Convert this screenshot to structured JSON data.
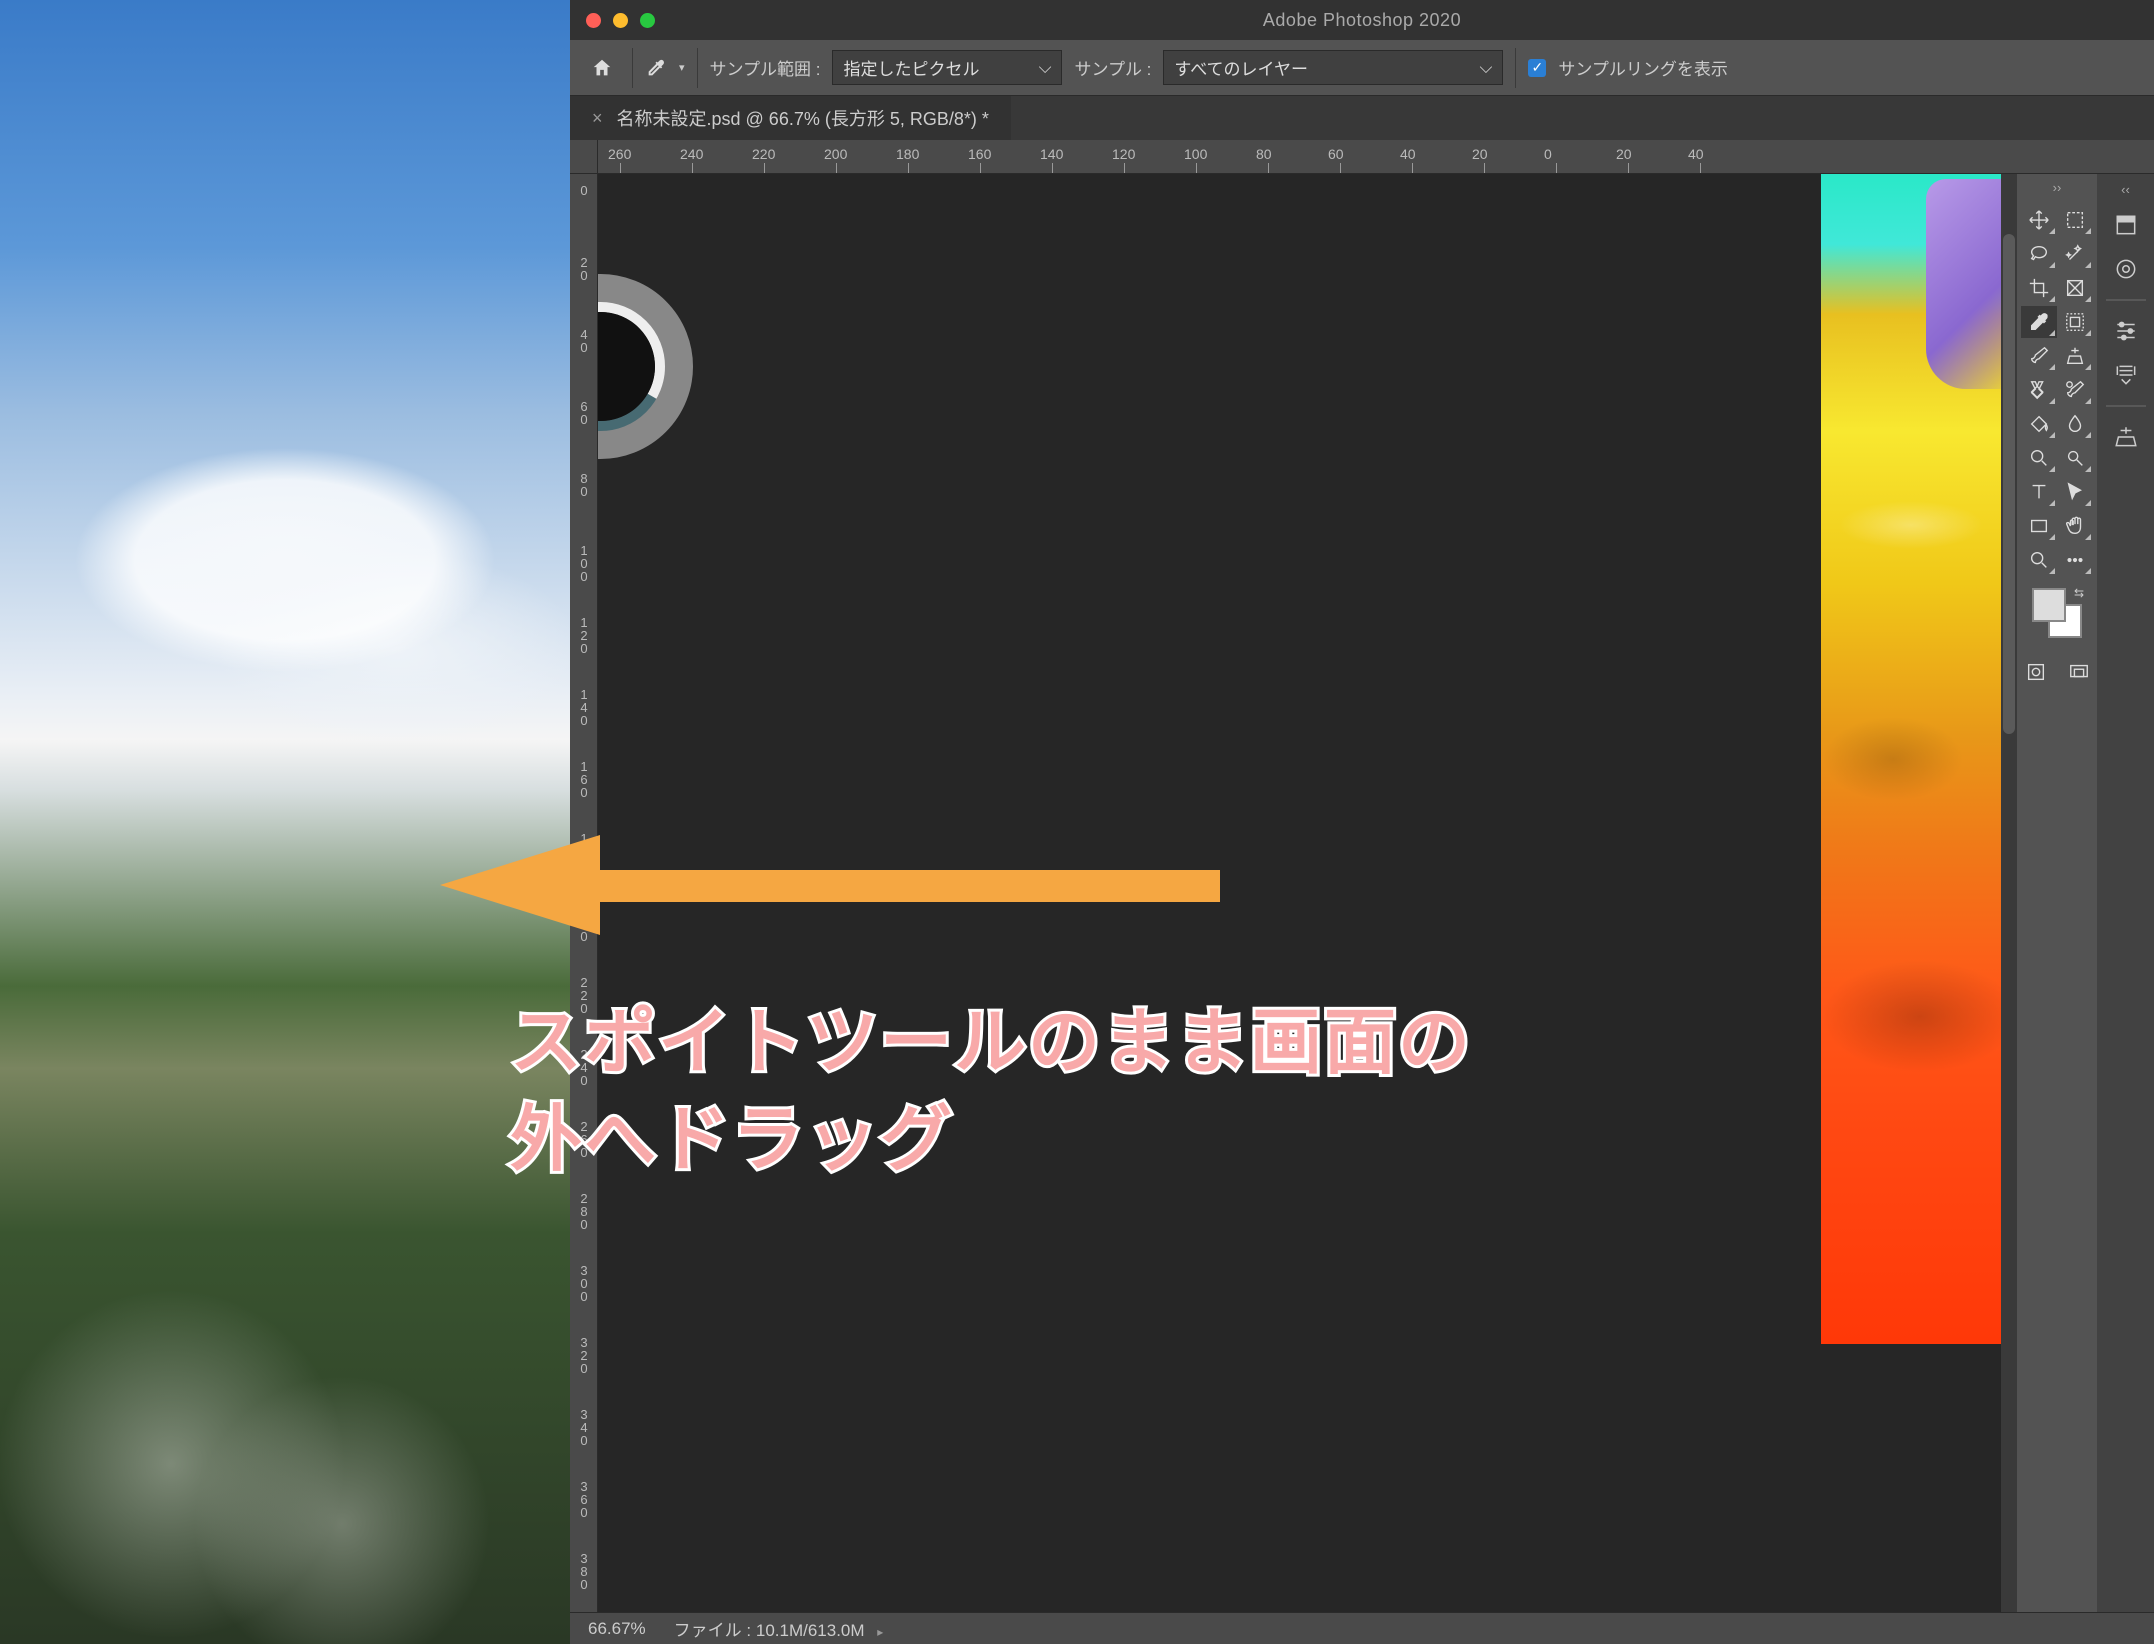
{
  "app_title": "Adobe Photoshop 2020",
  "options_bar": {
    "sample_size_label": "サンプル範囲 :",
    "sample_size_value": "指定したピクセル",
    "sample_layer_label": "サンプル :",
    "sample_layer_value": "すべてのレイヤー",
    "show_ring_label": "サンプルリングを表示"
  },
  "doc_tab": {
    "title": "名称未設定.psd @ 66.7% (長方形 5, RGB/8*) *"
  },
  "ruler_h": [
    "260",
    "240",
    "220",
    "200",
    "180",
    "160",
    "140",
    "120",
    "100",
    "80",
    "60",
    "40",
    "20",
    "0",
    "20",
    "40"
  ],
  "ruler_v": [
    "0",
    "20",
    "40",
    "60",
    "80",
    "100",
    "120",
    "140",
    "160",
    "180",
    "200",
    "220",
    "240",
    "260",
    "280",
    "300",
    "320",
    "340",
    "360",
    "380"
  ],
  "status": {
    "zoom": "66.67%",
    "file_label": "ファイル :",
    "file_value": "10.1M/613.0M"
  },
  "annotation": {
    "line1": "スポイトツールのまま画面の",
    "line2": "外へドラッグ"
  },
  "tools": [
    [
      "move-tool",
      "marquee-tool"
    ],
    [
      "lasso-tool",
      "magic-wand-tool"
    ],
    [
      "crop-tool",
      "frame-tool"
    ],
    [
      "eyedropper-tool",
      "frame-select-tool"
    ],
    [
      "brush-tool",
      "clone-stamp-tool"
    ],
    [
      "spot-heal-tool",
      "history-brush-tool"
    ],
    [
      "paint-bucket-tool",
      "blur-tool"
    ],
    [
      "zoom-tool",
      "dodge-tool"
    ],
    [
      "type-tool",
      "path-select-tool"
    ],
    [
      "rectangle-tool",
      "hand-tool"
    ],
    [
      "magnify-tool",
      "more-tool"
    ]
  ],
  "dock_icons": [
    "panel-layers-icon",
    "panel-channels-icon",
    "panel-color-icon",
    "panel-swatches-icon",
    "panel-stamps-icon"
  ]
}
